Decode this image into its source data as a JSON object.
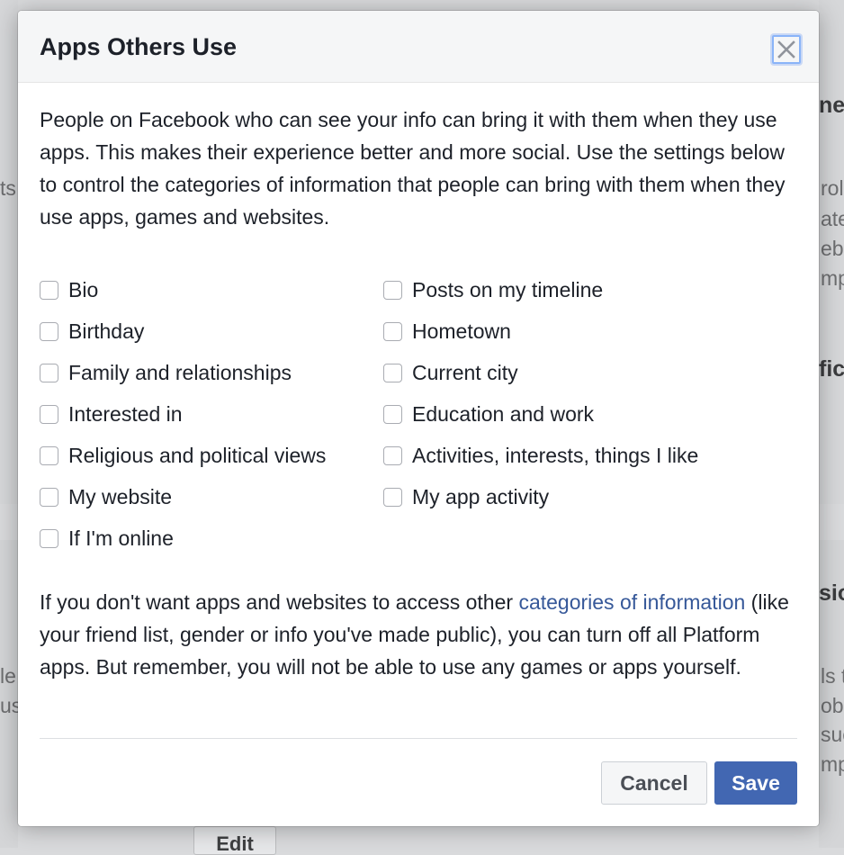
{
  "dialog": {
    "title": "Apps Others Use",
    "close_icon": "close-icon",
    "intro": "People on Facebook who can see your info can bring it with them when they use apps. This makes their experience better and more social. Use the settings below to control the categories of information that people can bring with them when they use apps, games and websites.",
    "options_left": [
      {
        "label": "Bio",
        "checked": false
      },
      {
        "label": "Birthday",
        "checked": false
      },
      {
        "label": "Family and relationships",
        "checked": false
      },
      {
        "label": "Interested in",
        "checked": false
      },
      {
        "label": "Religious and political views",
        "checked": false
      },
      {
        "label": "My website",
        "checked": false
      },
      {
        "label": "If I'm online",
        "checked": false
      }
    ],
    "options_right": [
      {
        "label": "Posts on my timeline",
        "checked": false
      },
      {
        "label": "Hometown",
        "checked": false
      },
      {
        "label": "Current city",
        "checked": false
      },
      {
        "label": "Education and work",
        "checked": false
      },
      {
        "label": "Activities, interests, things I like",
        "checked": false
      },
      {
        "label": "My app activity",
        "checked": false
      }
    ],
    "outro_before_link": "If you don't want apps and websites to access other ",
    "outro_link": "categories of information",
    "outro_after_link": " (like your friend list, gender or info you've made public), you can turn off all Platform apps. But remember, you will not be able to use any games or apps yourself.",
    "cancel_label": "Cancel",
    "save_label": "Save"
  },
  "background": {
    "fragments": [
      {
        "text": "ne",
        "bold": true
      },
      {
        "text": "ts",
        "bold": false
      },
      {
        "text": "rol",
        "bold": false
      },
      {
        "text": "ate",
        "bold": false
      },
      {
        "text": "ebo",
        "bold": false
      },
      {
        "text": "mp",
        "bold": false
      },
      {
        "text": "fic",
        "bold": true
      },
      {
        "text": "sio",
        "bold": true
      },
      {
        "text": "le",
        "bold": false
      },
      {
        "text": "us",
        "bold": false
      },
      {
        "text": "ls t",
        "bold": false
      },
      {
        "text": "obil",
        "bold": false
      },
      {
        "text": "suc",
        "bold": false
      },
      {
        "text": "mp",
        "bold": false
      }
    ],
    "edit_label": "Edit"
  },
  "colors": {
    "brand_blue": "#4267b2",
    "link_blue": "#365899",
    "text": "#1d2129"
  }
}
